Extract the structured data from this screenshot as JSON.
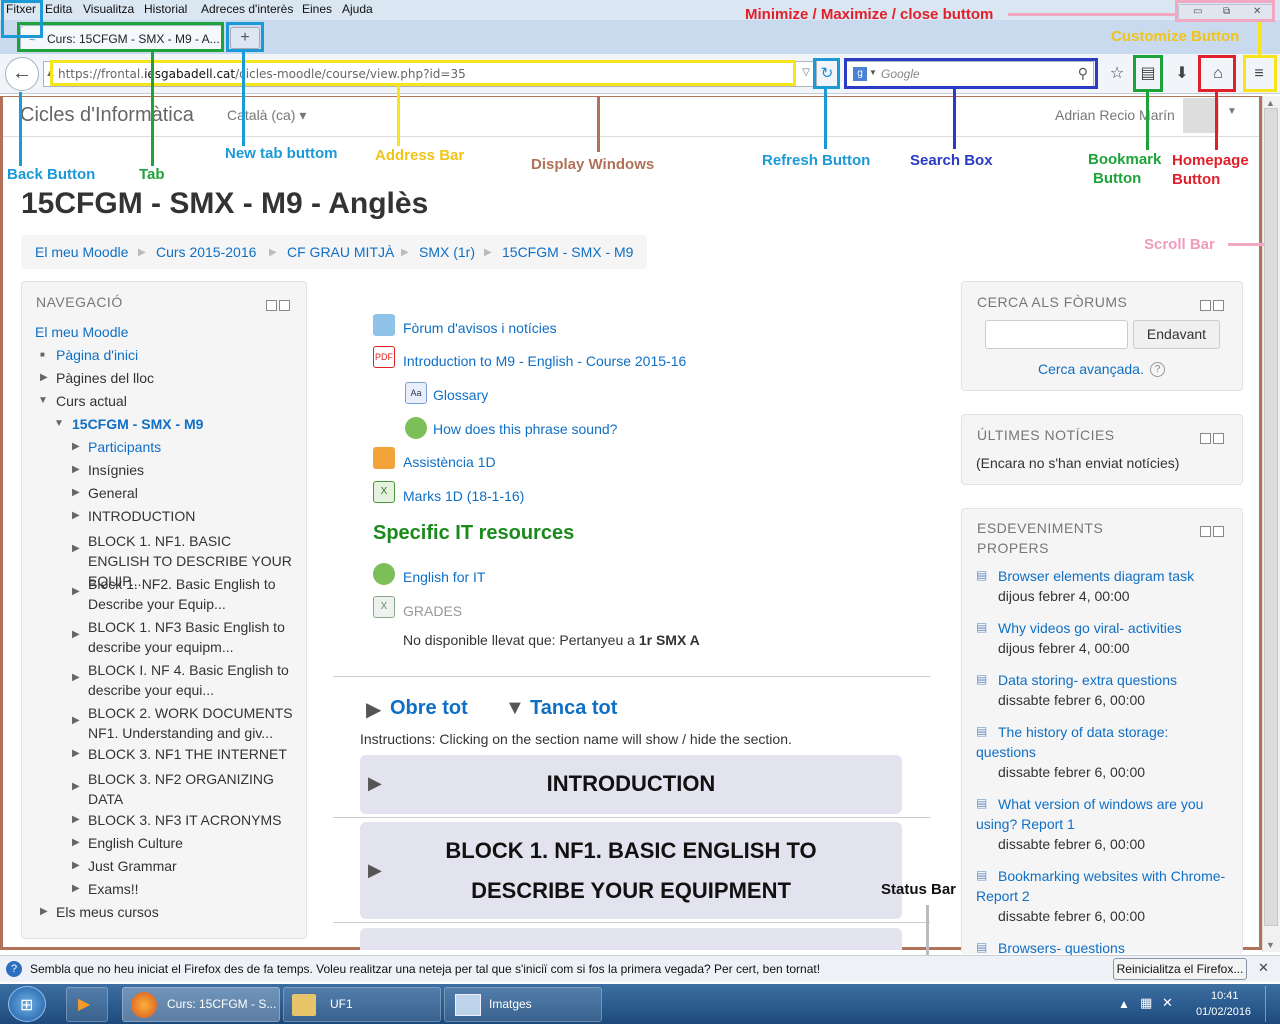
{
  "menu": [
    "Fitxer",
    "Edita",
    "Visualitza",
    "Historial",
    "Adreces d'interès",
    "Eines",
    "Ajuda"
  ],
  "tab": {
    "title": "Curs: 15CFGM - SMX - M9 - A...",
    "new_tab": "+"
  },
  "window_controls": {
    "minimize": "▭",
    "maximize": "⧉",
    "close": "✕"
  },
  "address": {
    "prefix": "https://frontal.",
    "domain": "iesgabadell.cat",
    "path": "/cicles-moodle/course/view.php?id=35"
  },
  "search": {
    "engine": "g",
    "placeholder": "Google"
  },
  "icons": {
    "back": "back-arrow-icon",
    "refresh": "refresh-icon",
    "bookmark_star": "star-icon",
    "bookmarks_list": "clipboard-icon",
    "downloads": "download-arrow-icon",
    "home": "home-icon",
    "menu": "hamburger-icon"
  },
  "annotations": {
    "window_controls": "Minimize / Maximize / close buttom",
    "customize": "Customize Button",
    "back": "Back Button",
    "tab": "Tab",
    "new_tab": "New tab buttom",
    "address": "Address Bar",
    "display": "Display Windows",
    "refresh": "Refresh Button",
    "search": "Search Box",
    "bookmark_1": "Bookmark",
    "bookmark_2": "Button",
    "homepage_1": "Homepage",
    "homepage_2": "Button",
    "scroll": "Scroll Bar",
    "status": "Status Bar"
  },
  "colors": {
    "blue_box": "#1c9ad6",
    "green_box": "#1ea33a",
    "yellow_box": "#f5e51a",
    "navy_box": "#2b3cc4",
    "red_box": "#e0202a",
    "brown_box": "#b0735a",
    "pink_box": "#f1a8c3",
    "yellow_text": "#f0c419",
    "pink_text": "#ef9cbc",
    "red_text": "#e0202a"
  },
  "site": {
    "name": "Cicles d'Informàtica",
    "language": "Català (ca)",
    "user": "Adrian Recio Marín"
  },
  "course_title": "15CFGM - SMX - M9 - Anglès",
  "breadcrumb": [
    "El meu Moodle",
    "Curs 2015-2016",
    "CF GRAU MITJÀ",
    "SMX (1r)",
    "15CFGM - SMX - M9"
  ],
  "navigation": {
    "heading": "NAVEGACIÓ",
    "home": "El meu Moodle",
    "site_home": "Pàgina d'inici",
    "site_pages": "Pàgines del lloc",
    "current_course": "Curs actual",
    "course": "15CFGM - SMX - M9",
    "items": [
      "Participants",
      "Insígnies",
      "General",
      "INTRODUCTION",
      "BLOCK 1. NF1. BASIC ENGLISH TO DESCRIBE YOUR EQUIP...",
      "Block 1. NF2. Basic English to Describe your Equip...",
      "BLOCK 1. NF3 Basic English to describe your equipm...",
      "BLOCK I. NF 4. Basic English to describe your equi...",
      "BLOCK 2. WORK DOCUMENTS NF1. Understanding and giv...",
      "BLOCK 3. NF1 THE INTERNET",
      "BLOCK 3. NF2 ORGANIZING DATA",
      "BLOCK 3. NF3 IT ACRONYMS",
      "English Culture",
      "Just Grammar",
      "Exams!!"
    ],
    "my_courses": "Els meus cursos"
  },
  "activities": [
    {
      "label": "Fòrum d'avisos i notícies",
      "icon": "forum-icon"
    },
    {
      "label": "Introduction to M9 - English - Course 2015-16",
      "icon": "pdf-icon"
    },
    {
      "label": "Glossary",
      "icon": "glossary-icon"
    },
    {
      "label": "How does this phrase sound?",
      "icon": "globe-icon"
    },
    {
      "label": "Assistència 1D",
      "icon": "attendance-icon"
    },
    {
      "label": "Marks 1D (18-1-16)",
      "icon": "spreadsheet-icon"
    }
  ],
  "specific": {
    "heading": "Specific IT resources",
    "english": "English for IT",
    "grades": "GRADES",
    "restriction_prefix": "No disponible llevat que: Pertanyeu a ",
    "restriction_group": "1r SMX A"
  },
  "sections": {
    "open_all": "Obre tot",
    "close_all": "Tanca tot",
    "instructions": "Instructions: Clicking on the section name will show / hide the section.",
    "intro": "INTRODUCTION",
    "block1_line1": "BLOCK 1. NF1. BASIC ENGLISH TO",
    "block1_line2": "DESCRIBE YOUR EQUIPMENT"
  },
  "forum_search": {
    "heading": "CERCA ALS FÒRUMS",
    "button": "Endavant",
    "advanced": "Cerca avançada."
  },
  "news": {
    "heading": "ÚLTIMES NOTÍCIES",
    "empty": "(Encara no s'han enviat notícies)"
  },
  "events": {
    "heading_1": "ESDEVENIMENTS",
    "heading_2": "PROPERS",
    "items": [
      {
        "title": "Browser elements diagram task",
        "date": "dijous febrer 4, 00:00"
      },
      {
        "title": "Why videos go viral- activities",
        "date": "dijous febrer 4, 00:00"
      },
      {
        "title": "Data storing- extra questions",
        "date": "dissabte febrer 6, 00:00"
      },
      {
        "title_1": "The history of data storage:",
        "title_2": "questions",
        "date": "dissabte febrer 6, 00:00"
      },
      {
        "title_1": "What version of windows are you",
        "title_2": "using? Report 1",
        "date": "dissabte febrer 6, 00:00"
      },
      {
        "title_1": "Bookmarking websites with Chrome-",
        "title_2": "Report 2",
        "date": "dissabte febrer 6, 00:00"
      },
      {
        "title": "Browsers- questions"
      }
    ]
  },
  "notification": {
    "text": "Sembla que no heu iniciat el Firefox des de fa temps. Voleu realitzar una neteja per tal que s'iniciï com si fos la primera vegada? Per cert, ben tornat!",
    "button": "Reinicialitza el Firefox..."
  },
  "taskbar": {
    "firefox": "Curs: 15CFGM - S...",
    "folder": "UF1",
    "images": "Imatges",
    "time": "10:41",
    "date": "01/02/2016"
  }
}
